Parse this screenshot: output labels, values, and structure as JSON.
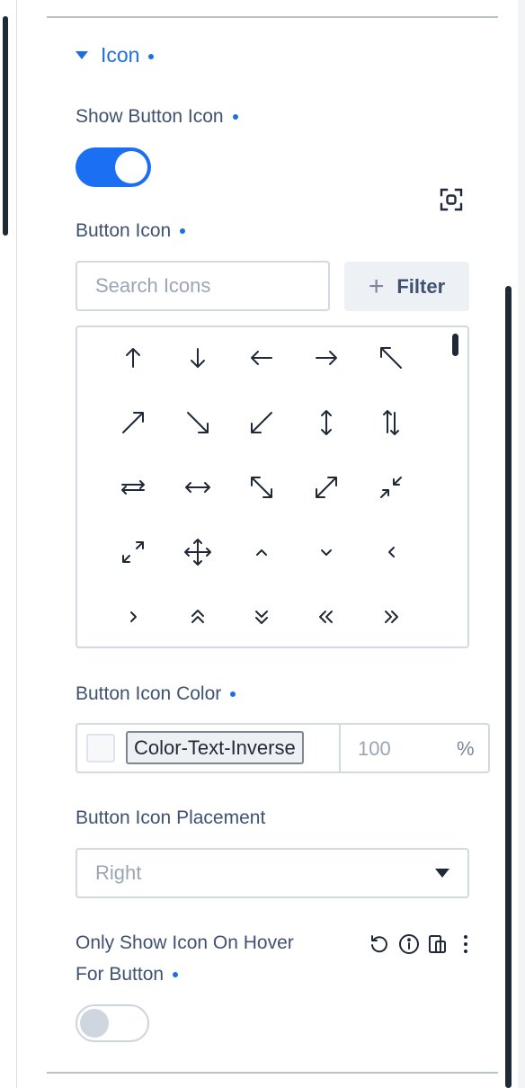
{
  "section": {
    "title": "Icon"
  },
  "show_icon": {
    "label": "Show Button Icon",
    "enabled": true
  },
  "button_icon": {
    "label": "Button Icon",
    "search_placeholder": "Search Icons",
    "filter_label": "Filter",
    "icons": [
      "arrow-up",
      "arrow-down",
      "arrow-left",
      "arrow-right",
      "arrow-up-left",
      "arrow-up-right",
      "arrow-down-right",
      "arrow-down-left",
      "arrow-up-down",
      "arrows-up-down",
      "arrows-left-right",
      "arrow-left-right",
      "arrow-expand-diagonal",
      "arrow-expand-diagonal-2",
      "arrow-collapse-diagonal",
      "arrows-maximize",
      "arrows-move",
      "chevron-up",
      "chevron-down",
      "chevron-left",
      "chevron-right",
      "chevrons-up",
      "chevrons-down",
      "chevrons-left",
      "chevrons-right"
    ]
  },
  "icon_color": {
    "label": "Button Icon Color",
    "value": "Color-Text-Inverse",
    "opacity_placeholder": "100",
    "unit": "%"
  },
  "placement": {
    "label": "Button Icon Placement",
    "value": "Right"
  },
  "hover_only": {
    "label_line1": "Only Show Icon On Hover",
    "label_line2": "For Button",
    "enabled": false,
    "tools": [
      "reset-icon",
      "info-icon",
      "responsive-icon",
      "more-vertical-icon"
    ]
  },
  "colors": {
    "accent": "#1a6ff2",
    "label": "#3f5270",
    "border": "#d3d9e1"
  }
}
